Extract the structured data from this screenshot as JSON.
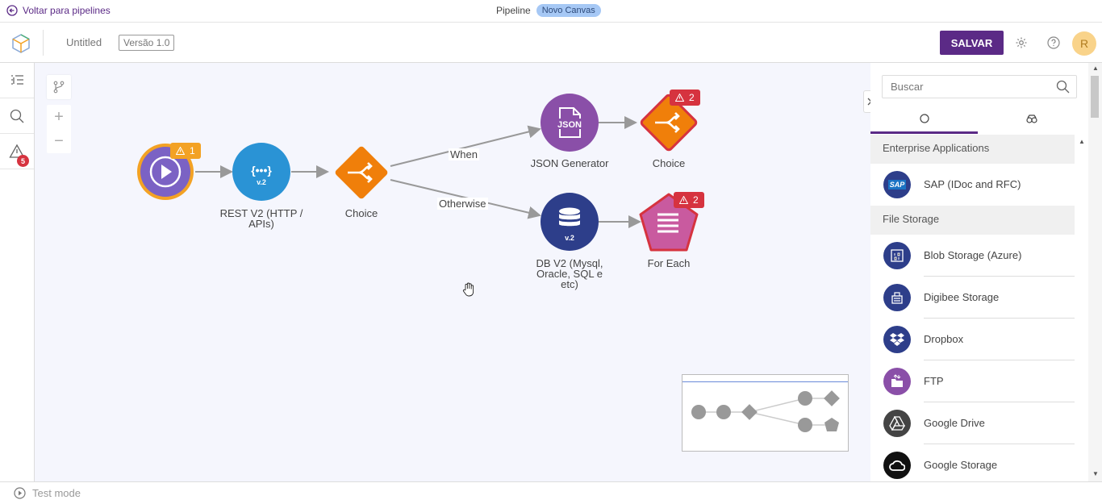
{
  "topbar": {
    "back_label": "Voltar para pipelines",
    "pipeline_label": "Pipeline",
    "canvas_badge": "Novo Canvas"
  },
  "header": {
    "title": "Untitled",
    "version": "Versão 1.0",
    "save_label": "SALVAR",
    "avatar_initial": "R"
  },
  "sidebar": {
    "warnings_count": "5"
  },
  "canvas": {
    "nodes": {
      "trigger": {
        "warning_count": "1"
      },
      "rest": {
        "glyph": "{•••}",
        "version": "v.2",
        "label_line1": "REST V2 (HTTP /",
        "label_line2": "APIs)"
      },
      "choice1": {
        "label": "Choice"
      },
      "json": {
        "glyph": "JSON",
        "label": "JSON Generator"
      },
      "choice2": {
        "label": "Choice",
        "error_count": "2"
      },
      "db": {
        "version": "v.2",
        "label_line1": "DB V2 (Mysql,",
        "label_line2": "Oracle, SQL e",
        "label_line3": "etc)"
      },
      "foreach": {
        "label": "For Each",
        "error_count": "2"
      }
    },
    "edges": {
      "when": "When",
      "otherwise": "Otherwise"
    }
  },
  "palette": {
    "search_placeholder": "Buscar",
    "sections": [
      {
        "title": "Enterprise Applications",
        "items": [
          {
            "label": "SAP (IDoc and RFC)",
            "icon": "sap-icon"
          }
        ]
      },
      {
        "title": "File Storage",
        "items": [
          {
            "label": "Blob Storage (Azure)",
            "icon": "blob-storage-icon"
          },
          {
            "label": "Digibee Storage",
            "icon": "digibee-storage-icon"
          },
          {
            "label": "Dropbox",
            "icon": "dropbox-icon"
          },
          {
            "label": "FTP",
            "icon": "ftp-icon"
          },
          {
            "label": "Google Drive",
            "icon": "google-drive-icon"
          },
          {
            "label": "Google Storage",
            "icon": "google-storage-icon"
          }
        ]
      }
    ]
  },
  "bottombar": {
    "test_mode": "Test mode"
  },
  "colors": {
    "brand": "#5b2a86",
    "orange": "#f07f0a",
    "error": "#d6333f",
    "warning": "#f3a224",
    "navy": "#2d3e8a"
  }
}
